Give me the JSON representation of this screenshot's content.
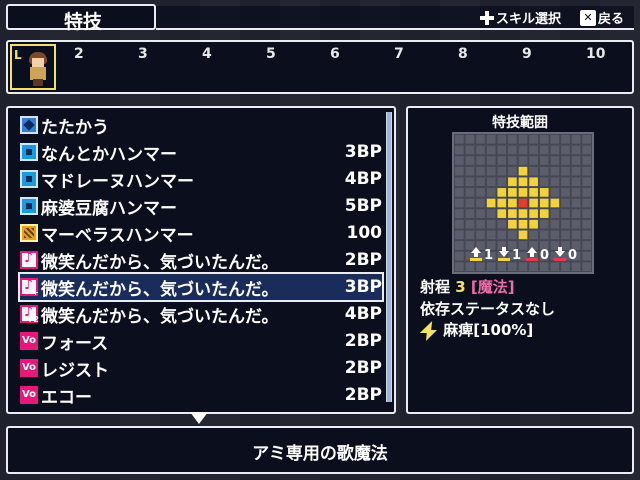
{
  "header": {
    "title": "特技",
    "hints": [
      {
        "label": "スキル選択",
        "icon": "dpad-icon"
      },
      {
        "label": "戻る",
        "icon": "x-button-icon"
      }
    ]
  },
  "party": {
    "selected_marker": "L",
    "slots": [
      "2",
      "3",
      "4",
      "5",
      "6",
      "7",
      "8",
      "9",
      "10"
    ]
  },
  "skills": [
    {
      "name": "たたかう",
      "cost": "",
      "icon": "sword-skill-icon"
    },
    {
      "name": "なんとかハンマー",
      "cost": "3BP",
      "icon": "hammer-skill-icon"
    },
    {
      "name": "マドレーヌハンマー",
      "cost": "4BP",
      "icon": "hammer-skill-icon"
    },
    {
      "name": "麻婆豆腐ハンマー",
      "cost": "5BP",
      "icon": "hammer-skill-icon"
    },
    {
      "name": "マーベラスハンマー",
      "cost": "100",
      "icon": "special-skill-icon"
    },
    {
      "name": "微笑んだから、気づいたんだ。",
      "cost": "2BP",
      "icon": "song-icon"
    },
    {
      "name": "微笑んだから、気づいたんだ。",
      "cost": "3BP",
      "icon": "song-plus-icon",
      "badge": "+"
    },
    {
      "name": "微笑んだから、気づいたんだ。",
      "cost": "4BP",
      "icon": "song-plus2-icon",
      "badge": "+2"
    },
    {
      "name": "フォース",
      "cost": "2BP",
      "icon": "vo-icon"
    },
    {
      "name": "レジスト",
      "cost": "2BP",
      "icon": "vo-icon"
    },
    {
      "name": "エコー",
      "cost": "2BP",
      "icon": "vo-icon"
    }
  ],
  "selected_index": 6,
  "range_panel": {
    "title": "特技範囲",
    "stats": [
      "1",
      "1",
      "0",
      "0"
    ],
    "range_label": "射程",
    "range_value": "3",
    "range_type": "[魔法]",
    "dependency": "依存ステータスなし",
    "effect": "麻痺[100%]"
  },
  "description": "アミ専用の歌魔法",
  "colors": {
    "panel_bg": "#0a0e1c",
    "border": "#e9ecf2",
    "highlight_yellow": "#f3e26a",
    "highlight_pink": "#f06aa8",
    "grid_center": "#e83a2a",
    "grid_area": "#f3d23a"
  }
}
